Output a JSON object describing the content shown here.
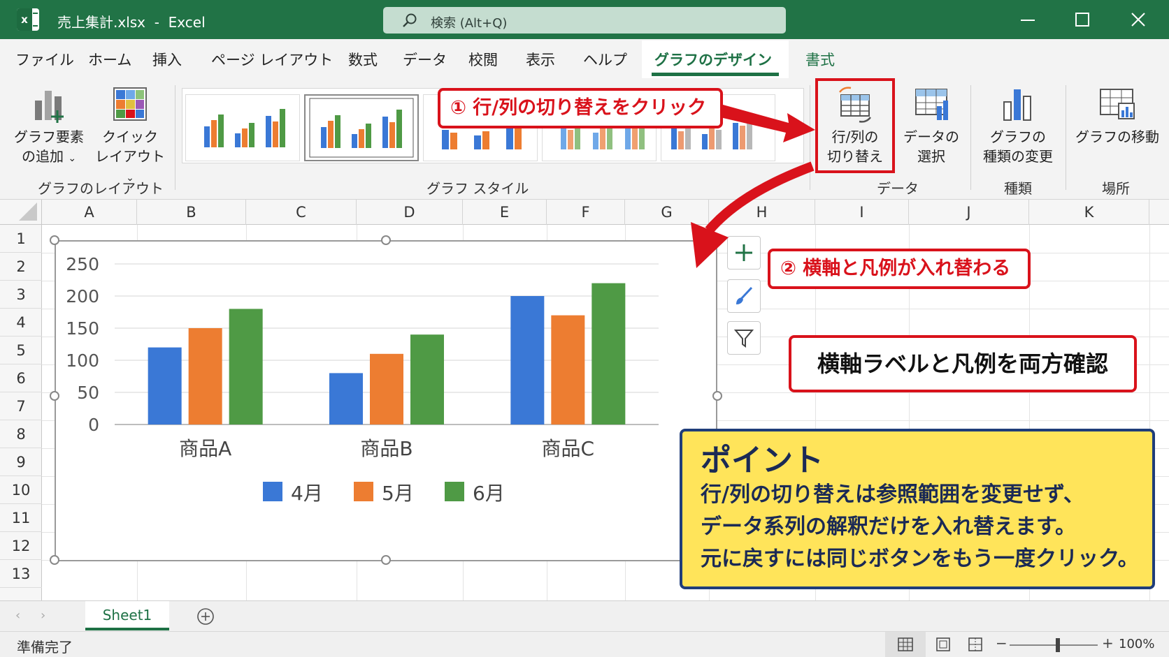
{
  "window": {
    "file_name": "売上集計.xlsx",
    "separator": "-",
    "app_name": "Excel",
    "search_placeholder": "検索 (Alt+Q)"
  },
  "tabs": [
    {
      "label": "ファイル"
    },
    {
      "label": "ホーム"
    },
    {
      "label": "挿入"
    },
    {
      "label": "ページ レイアウト"
    },
    {
      "label": "数式"
    },
    {
      "label": "データ"
    },
    {
      "label": "校閲"
    },
    {
      "label": "表示"
    },
    {
      "label": "ヘルプ"
    },
    {
      "label": "グラフのデザイン",
      "active": true
    },
    {
      "label": "書式"
    }
  ],
  "ribbon": {
    "add_element": {
      "line1": "グラフ要素",
      "line2": "の追加"
    },
    "quick_layout": {
      "line1": "クイック",
      "line2": "レイアウト"
    },
    "switch_row_col": {
      "line1": "行/列の",
      "line2": "切り替え"
    },
    "select_data": {
      "line1": "データの",
      "line2": "選択"
    },
    "change_type": {
      "line1": "グラフの",
      "line2": "種類の変更"
    },
    "move_chart": {
      "label": "グラフの移動"
    },
    "groups": {
      "layout": "グラフのレイアウト",
      "styles": "グラフ スタイル",
      "data": "データ",
      "type": "種類",
      "location": "場所"
    }
  },
  "columns": [
    "A",
    "B",
    "C",
    "D",
    "E",
    "F",
    "G",
    "H",
    "I",
    "J",
    "K"
  ],
  "rows": [
    "1",
    "2",
    "3",
    "4",
    "5",
    "6",
    "7",
    "8",
    "9",
    "10",
    "11",
    "12",
    "13"
  ],
  "chart_data": {
    "type": "bar",
    "categories": [
      "商品A",
      "商品B",
      "商品C"
    ],
    "series": [
      {
        "name": "4月",
        "color": "#3a78d6",
        "values": [
          120,
          80,
          200
        ]
      },
      {
        "name": "5月",
        "color": "#ed7d31",
        "values": [
          150,
          110,
          170
        ]
      },
      {
        "name": "6月",
        "color": "#4f9a45",
        "values": [
          180,
          140,
          220
        ]
      }
    ],
    "yticks": [
      "0",
      "50",
      "100",
      "150",
      "200",
      "250"
    ],
    "ylim": [
      0,
      250
    ],
    "grid": true,
    "legend": "bottom"
  },
  "callouts": {
    "step1": "① 行/列の切り替えをクリック",
    "step2": "② 横軸と凡例が入れ替わる",
    "check": "横軸ラベルと凡例を両方確認"
  },
  "point": {
    "title": "ポイント",
    "lines": [
      "行/列の切り替えは参照範囲を変更せず、",
      "データ系列の解釈だけを入れ替えます。",
      "元に戻すには同じボタンをもう一度クリック。"
    ]
  },
  "sheet": {
    "name": "Sheet1"
  },
  "status": {
    "ready": "準備完了",
    "zoom": "100%"
  },
  "colors": {
    "excel_green": "#217346",
    "callout_red": "#d9121b",
    "point_yellow": "#ffe45a",
    "point_border": "#1f3d7a"
  }
}
